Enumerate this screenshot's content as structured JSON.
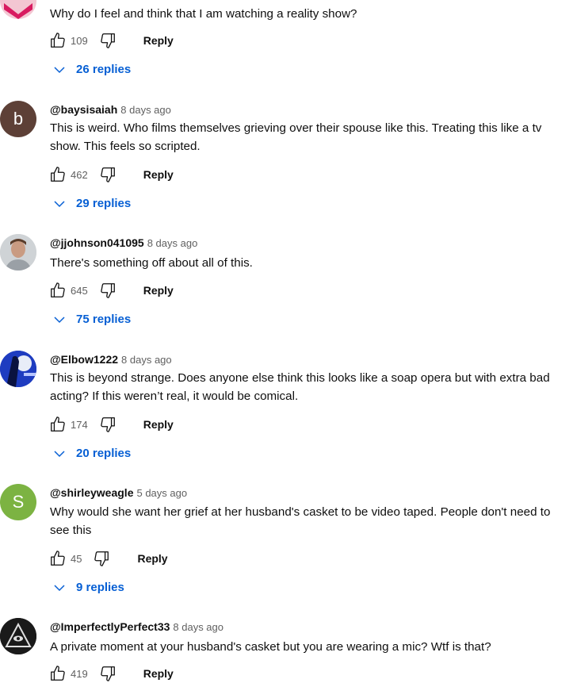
{
  "comments": [
    {
      "author": "",
      "time": "",
      "text": "Why do I feel and think that I am watching a reality show?",
      "likes": "109",
      "reply_label": "Reply",
      "replies_label": "26 replies",
      "avatar": {
        "kind": "image",
        "color": "#e0446b"
      }
    },
    {
      "author": "@baysisaiah",
      "time": "8 days ago",
      "text": "This is weird. Who films themselves grieving over their spouse like this. Treating this like a tv show. This feels so scripted.",
      "likes": "462",
      "reply_label": "Reply",
      "replies_label": "29 replies",
      "avatar": {
        "kind": "letter",
        "letter": "b",
        "color": "#5d4037"
      }
    },
    {
      "author": "@jjohnson041095",
      "time": "8 days ago",
      "text": "There's something off about all of this.",
      "likes": "645",
      "reply_label": "Reply",
      "replies_label": "75 replies",
      "avatar": {
        "kind": "image",
        "color": "#8d8d8d"
      }
    },
    {
      "author": "@Elbow1222",
      "time": "8 days ago",
      "text": "This is beyond strange. Does anyone else think this looks like a soap opera but with extra bad acting?  If this weren’t real, it would be comical.",
      "likes": "174",
      "reply_label": "Reply",
      "replies_label": "20 replies",
      "avatar": {
        "kind": "image",
        "color": "#1e40c8"
      }
    },
    {
      "author": "@shirleyweagle",
      "time": "5 days ago",
      "text": "Why would she want her grief at her husband's casket to be video taped.  People don't need to see this",
      "likes": "45",
      "reply_label": "Reply",
      "replies_label": "9 replies",
      "avatar": {
        "kind": "letter",
        "letter": "S",
        "color": "#7cb342"
      }
    },
    {
      "author": "@ImperfectlyPerfect33",
      "time": "8 days ago",
      "text": "A private moment at your husband's casket but you are wearing a mic? Wtf is that?",
      "likes": "419",
      "reply_label": "Reply",
      "replies_label": "",
      "avatar": {
        "kind": "image",
        "color": "#1a1a1a"
      }
    }
  ],
  "icons": {
    "like": "thumb-up-icon",
    "dislike": "thumb-down-icon",
    "expand": "chevron-down-icon"
  },
  "colors": {
    "link": "#065fd4",
    "meta": "#606060",
    "text": "#0f0f0f"
  }
}
